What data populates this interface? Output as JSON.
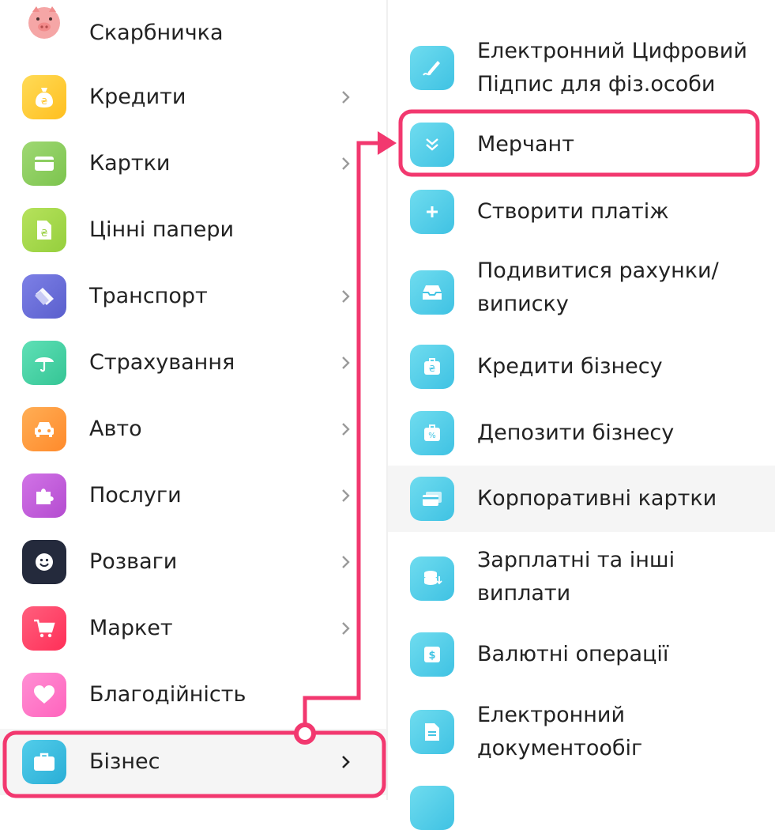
{
  "left_menu": {
    "items": [
      {
        "label": "Скарбничка",
        "icon": "piggy-bank-icon",
        "color": "#f7b6b6",
        "has_submenu": false
      },
      {
        "label": "Кредити",
        "icon": "money-bag-icon",
        "color": "#ffcc33",
        "has_submenu": true
      },
      {
        "label": "Картки",
        "icon": "card-icon",
        "color": "#8dcf5d",
        "has_submenu": true
      },
      {
        "label": "Цінні папери",
        "icon": "document-hryvnia-icon",
        "color": "#a6d94c",
        "has_submenu": false
      },
      {
        "label": "Транспорт",
        "icon": "ticket-icon",
        "color": "#6a6fd9",
        "has_submenu": true
      },
      {
        "label": "Страхування",
        "icon": "umbrella-icon",
        "color": "#45d4a6",
        "has_submenu": true
      },
      {
        "label": "Авто",
        "icon": "car-icon",
        "color": "#ff9b3d",
        "has_submenu": true
      },
      {
        "label": "Послуги",
        "icon": "puzzle-icon",
        "color": "#c45bdc",
        "has_submenu": true
      },
      {
        "label": "Розваги",
        "icon": "smile-icon",
        "color": "#242a3c",
        "has_submenu": true
      },
      {
        "label": "Маркет",
        "icon": "cart-icon",
        "color": "#ff4467",
        "has_submenu": true
      },
      {
        "label": "Благодійність",
        "icon": "heart-icon",
        "color": "#ff77c8",
        "has_submenu": false
      },
      {
        "label": "Бізнес",
        "icon": "briefcase-icon",
        "color": "#39b8df",
        "has_submenu": true
      }
    ]
  },
  "right_menu": {
    "items": [
      {
        "lines": [
          "Електронний Цифровий",
          "Підпис для фіз.особи"
        ],
        "icon": "pen-signature-icon"
      },
      {
        "lines": [
          "Мерчант"
        ],
        "icon": "double-chevron-down-icon"
      },
      {
        "lines": [
          "Створити платіж"
        ],
        "icon": "plus-icon"
      },
      {
        "lines": [
          "Подивитися рахунки/",
          "виписку"
        ],
        "icon": "inbox-tray-icon"
      },
      {
        "lines": [
          "Кредити бізнесу"
        ],
        "icon": "briefcase-hryvnia-icon"
      },
      {
        "lines": [
          "Депозити бізнесу"
        ],
        "icon": "briefcase-percent-icon"
      },
      {
        "lines": [
          "Корпоративні картки"
        ],
        "icon": "cards-icon"
      },
      {
        "lines": [
          "Зарплатні та інші",
          "виплати"
        ],
        "icon": "coins-stack-icon"
      },
      {
        "lines": [
          "Валютні операції"
        ],
        "icon": "dollar-bill-icon"
      },
      {
        "lines": [
          "Електронний",
          "документообіг"
        ],
        "icon": "document-icon"
      }
    ]
  },
  "highlight_color": "#f2386f",
  "accent_color": "#3fc2e3"
}
